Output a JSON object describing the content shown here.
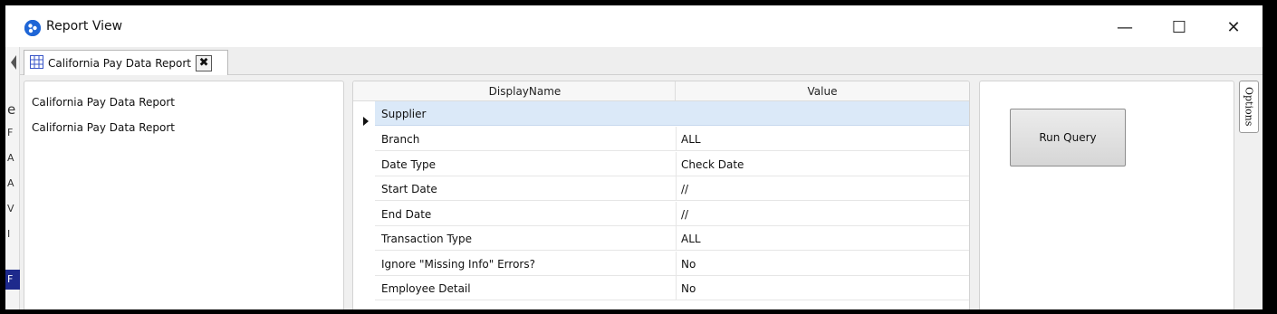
{
  "window": {
    "title": "Report View",
    "minimize_glyph": "—",
    "maximize_glyph": "☐",
    "close_glyph": "✕"
  },
  "background_app": {
    "letters": [
      "e",
      "F",
      "A",
      "A",
      "V",
      "I",
      "F"
    ],
    "accent_color": "#1e2a8c"
  },
  "tab": {
    "label": "California Pay Data Report",
    "icon": "grid-icon",
    "close_glyph": "✖"
  },
  "left_panel": {
    "items": [
      "California Pay Data Report",
      "California Pay Data Report"
    ]
  },
  "grid": {
    "columns": [
      "DisplayName",
      "Value"
    ],
    "rows": [
      {
        "name": "Supplier",
        "value": ""
      },
      {
        "name": "Branch",
        "value": "ALL"
      },
      {
        "name": "Date Type",
        "value": "Check Date"
      },
      {
        "name": "Start Date",
        "value": "//"
      },
      {
        "name": "End Date",
        "value": "//"
      },
      {
        "name": "Transaction Type",
        "value": "ALL"
      },
      {
        "name": "Ignore \"Missing Info\" Errors?",
        "value": "No"
      },
      {
        "name": "Employee Detail",
        "value": "No"
      }
    ],
    "selected_row": 0,
    "selection_color": "#dbe9f8"
  },
  "right_panel": {
    "run_button_label": "Run Query"
  },
  "options_tab": {
    "label": "Options"
  }
}
